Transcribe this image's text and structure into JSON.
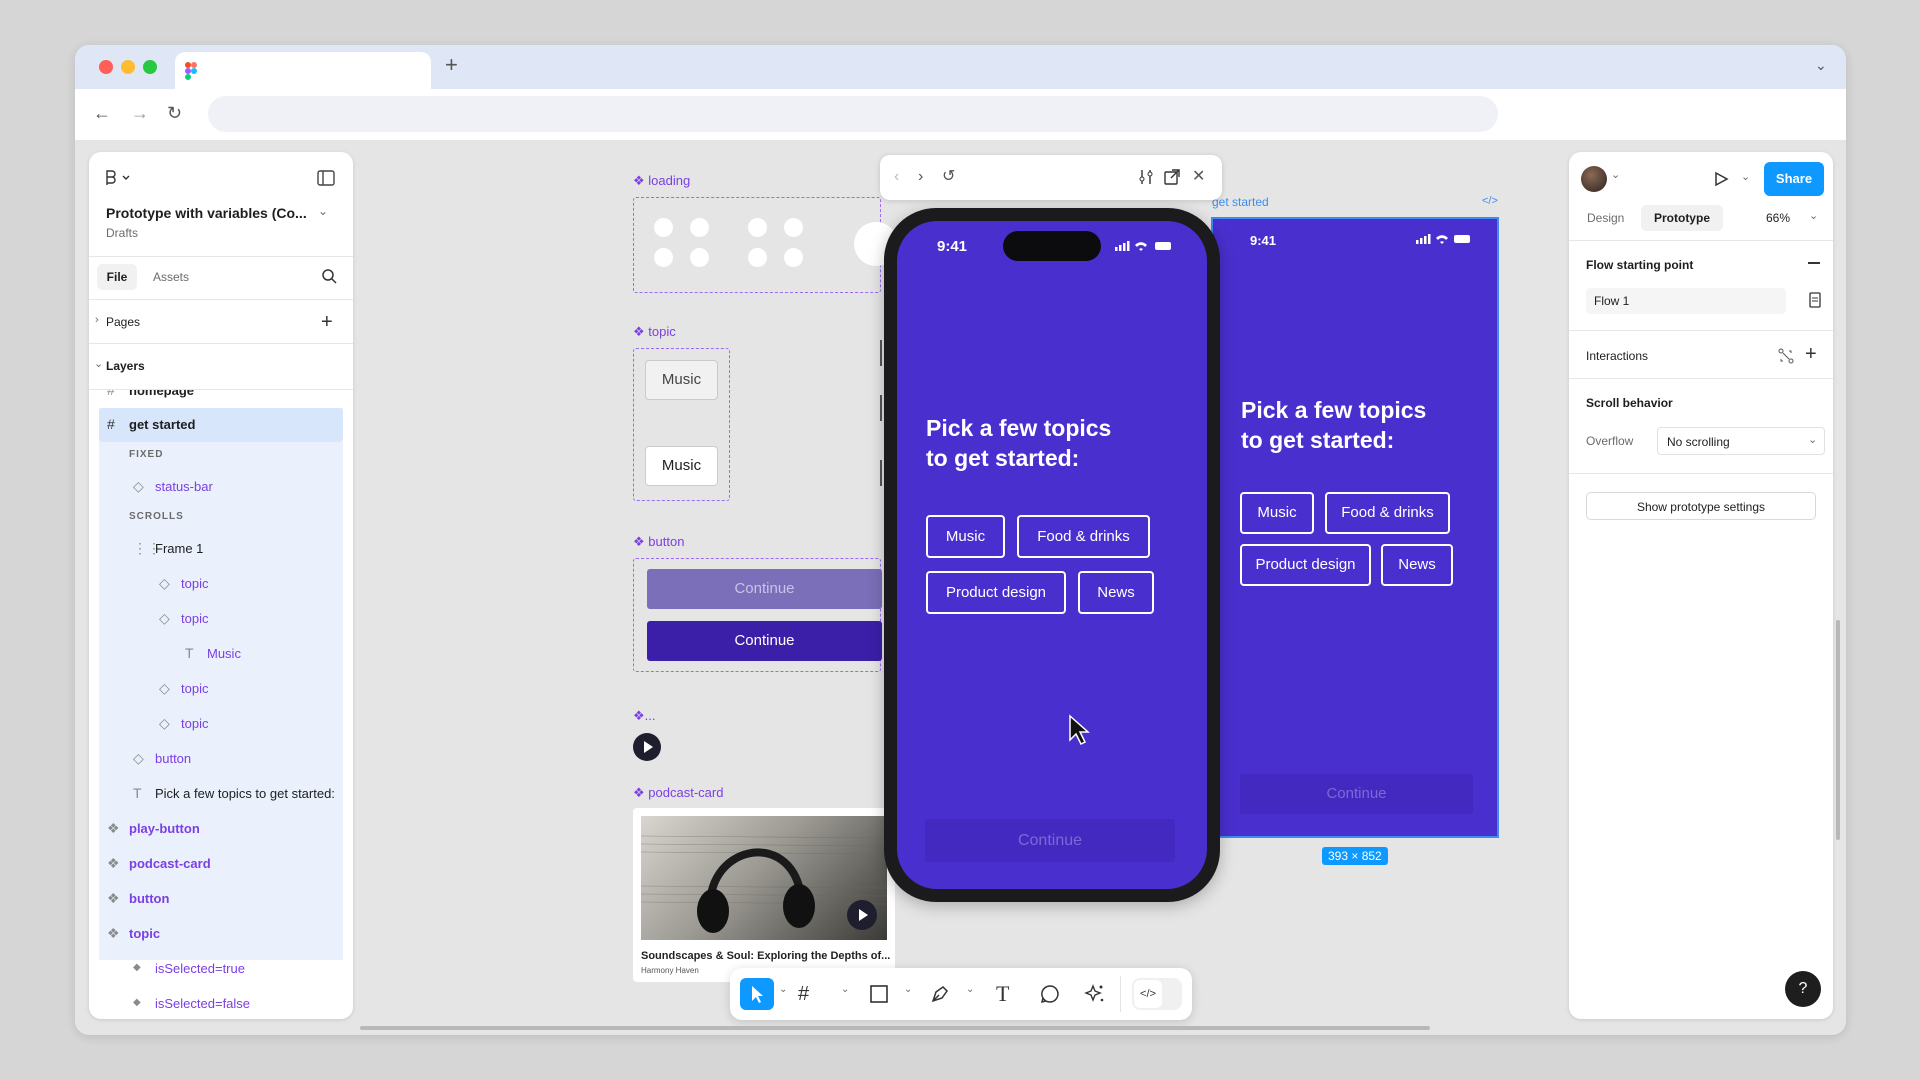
{
  "file": {
    "title": "Prototype with variables (Co...",
    "subtitle": "Drafts",
    "tabs": [
      "File",
      "Assets"
    ],
    "pages_label": "Pages",
    "layers_label": "Layers"
  },
  "layers": {
    "partial_top": "homepage",
    "selected": "get started",
    "fixed_label": "FIXED",
    "status_bar": "status-bar",
    "scrolls_label": "SCROLLS",
    "frame1": "Frame 1",
    "topic1": "topic",
    "topic2": "topic",
    "music_text": "Music",
    "topic3": "topic",
    "topic4": "topic",
    "button": "button",
    "heading_text": "Pick a few topics to get started:",
    "components": [
      "play-button",
      "podcast-card",
      "button",
      "topic"
    ],
    "variants": [
      "isSelected=true",
      "isSelected=false"
    ]
  },
  "canvas": {
    "loading_label": "loading",
    "topic_label": "topic",
    "topic_chip_1": "Music",
    "topic_chip_2": "Music",
    "button_label": "button",
    "continue_disabled": "Continue",
    "continue_enabled": "Continue",
    "play_label": "...",
    "podcast_label": "podcast-card",
    "podcast_title": "Soundscapes & Soul: Exploring the Depths of...",
    "podcast_author": "Harmony Haven",
    "frame_label": "get started",
    "frame_size": "393 × 852"
  },
  "phone": {
    "time": "9:41",
    "heading_line1": "Pick a few topics",
    "heading_line2": "to get started:",
    "topics": [
      "Music",
      "Food & drinks",
      "Product design",
      "News"
    ],
    "continue": "Continue"
  },
  "frame2": {
    "time": "9:41",
    "heading_line1": "Pick a few topics",
    "heading_line2": "to get started:",
    "topics": [
      "Music",
      "Food & drinks",
      "Product design",
      "News"
    ],
    "continue": "Continue"
  },
  "right": {
    "share": "Share",
    "tab_design": "Design",
    "tab_prototype": "Prototype",
    "zoom": "66%",
    "flow_start": "Flow starting point",
    "flow_name": "Flow 1",
    "interactions": "Interactions",
    "scroll_behavior": "Scroll behavior",
    "overflow_label": "Overflow",
    "overflow_value": "No scrolling",
    "show_settings": "Show prototype settings",
    "help": "?"
  },
  "colors": {
    "accent": "#0d99ff",
    "purple_frame": "#4a2fcf",
    "component": "#7b3fe4",
    "continue_dark": "#3b1fa8"
  }
}
